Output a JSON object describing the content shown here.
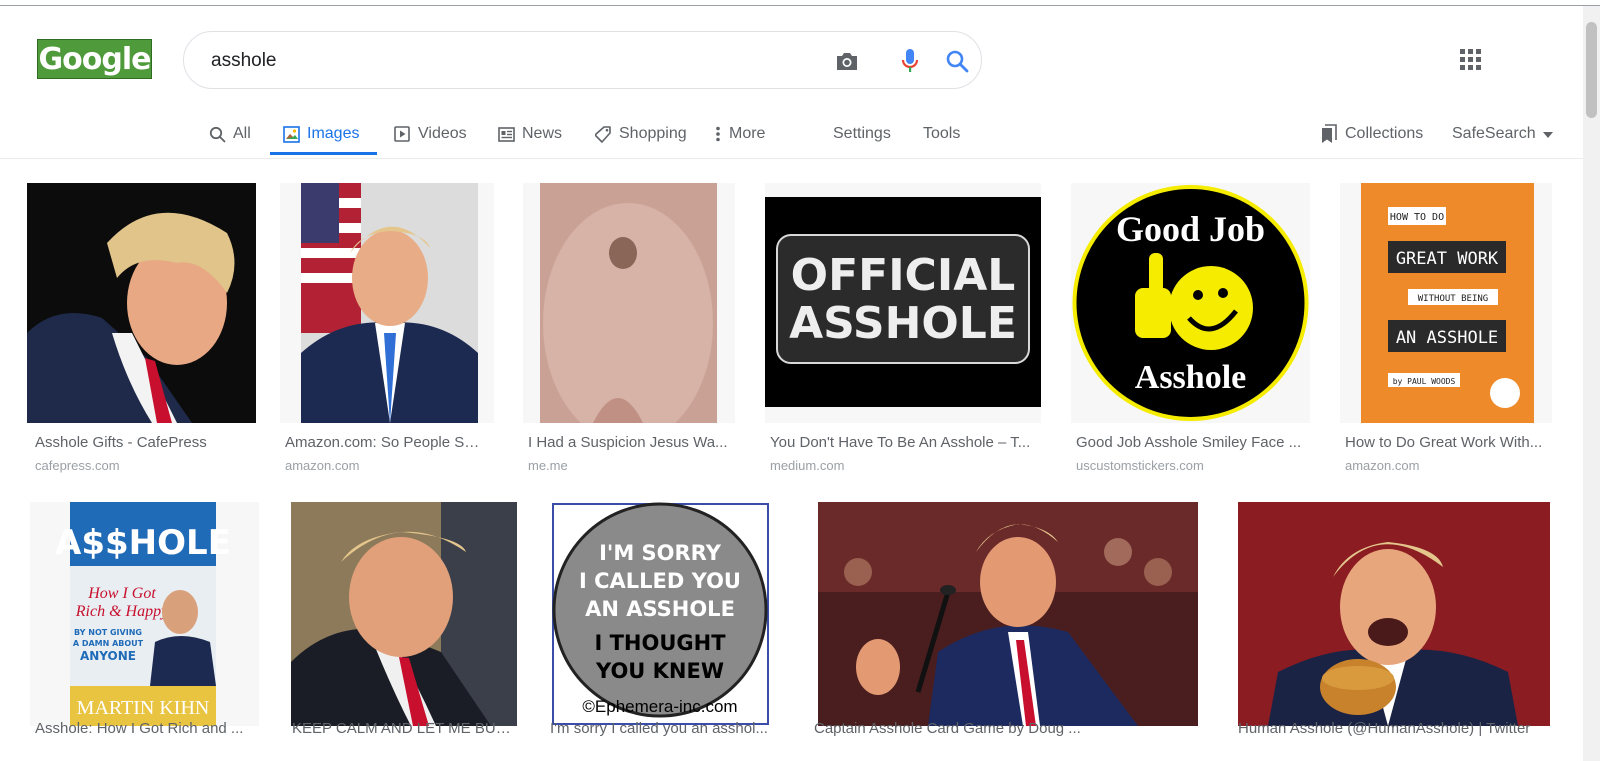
{
  "logo": {
    "text": "Google"
  },
  "search": {
    "query": "asshole"
  },
  "tabs": [
    {
      "label": "All",
      "icon": "search-icon"
    },
    {
      "label": "Images",
      "icon": "image-icon"
    },
    {
      "label": "Videos",
      "icon": "play-icon"
    },
    {
      "label": "News",
      "icon": "newspaper-icon"
    },
    {
      "label": "Shopping",
      "icon": "tag-icon"
    },
    {
      "label": "More",
      "icon": "more-vert-icon"
    },
    {
      "label": "Settings"
    },
    {
      "label": "Tools"
    }
  ],
  "right_tools": {
    "collections": "Collections",
    "safesearch": "SafeSearch"
  },
  "results": [
    {
      "caption": "Asshole Gifts - CafePress",
      "domain": "cafepress.com"
    },
    {
      "caption": "Amazon.com: So People Sa...",
      "domain": "amazon.com"
    },
    {
      "caption": "I Had a Suspicion Jesus Wa...",
      "domain": "me.me"
    },
    {
      "caption": "You Don't Have To Be An Asshole – T...",
      "domain": "medium.com"
    },
    {
      "caption": "Good Job Asshole Smiley Face ...",
      "domain": "uscustomstickers.com"
    },
    {
      "caption": "How to Do Great Work With...",
      "domain": "amazon.com"
    },
    {
      "caption": "Asshole: How I Got Rich and ...",
      "domain": ""
    },
    {
      "caption": "KEEP CALM AND LET ME BUR...",
      "domain": ""
    },
    {
      "caption": "I'm sorry I called you an asshol...",
      "domain": ""
    },
    {
      "caption": "Captain Asshole Card Game by Doug ...",
      "domain": ""
    },
    {
      "caption": "Human Asshole (@HumanAsshole) | Twitter",
      "domain": ""
    }
  ],
  "image_text": {
    "official": [
      "OFFICIAL",
      "ASSHOLE"
    ],
    "goodjob_top": "Good Job",
    "goodjob_bottom": "Asshole",
    "book_lines": [
      "HOW TO DO",
      "GREAT WORK",
      "WITHOUT BEING",
      "AN ASSHOLE",
      "by PAUL WOODS"
    ],
    "book2_title": "A$$HOLE",
    "book2_sub": [
      "How I Got",
      "Rich & Happy"
    ],
    "book2_side": [
      "BY NOT GIVING",
      "A DAMN ABOUT",
      "ANYONE"
    ],
    "book2_author": "MARTIN KIHN",
    "sorry_lines": [
      "I'M SORRY",
      "I CALLED YOU",
      "AN ASSHOLE",
      "I THOUGHT",
      "YOU KNEW"
    ],
    "sorry_copyright": "©Ephemera-inc.com"
  },
  "colors": {
    "accent": "#1a73e8",
    "caption": "#5f6368",
    "domain": "#9aa0a6",
    "goodjob_yellow": "#f5ec00",
    "book_orange": "#ef8a2b",
    "book2_blue": "#1f6bb8"
  }
}
